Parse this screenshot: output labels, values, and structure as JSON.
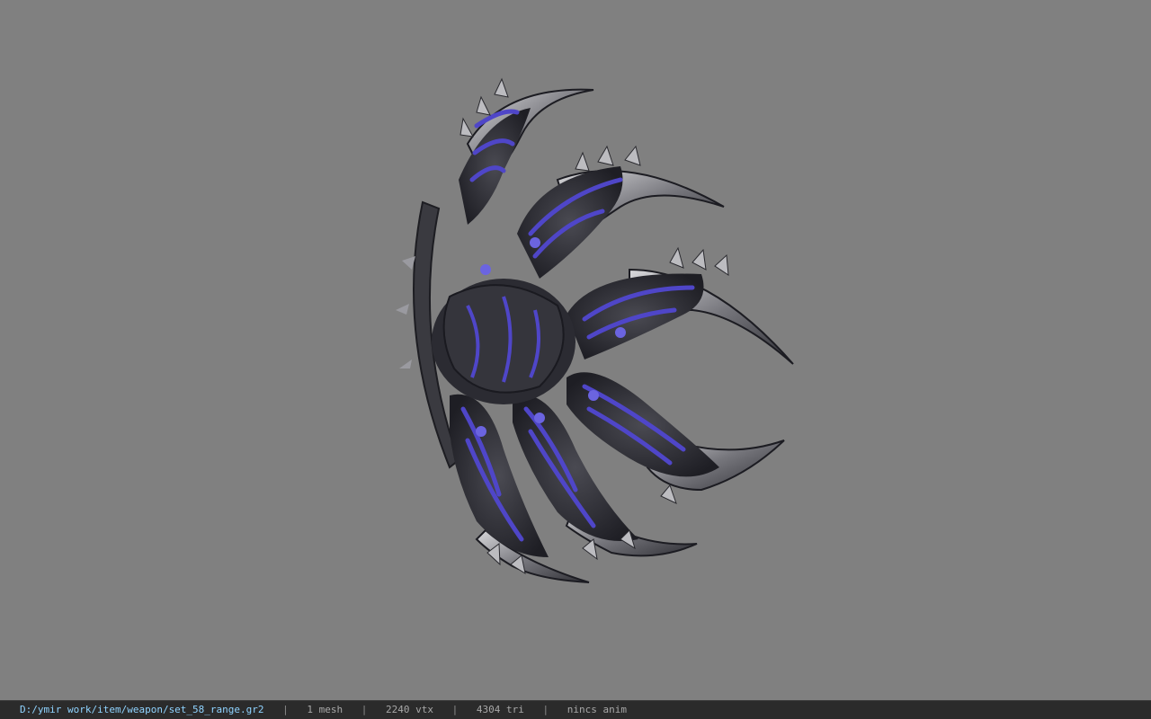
{
  "viewer": {
    "background_color": "#808080",
    "model": {
      "icon": "weapon-model-crescent-claw",
      "colors": {
        "metal_dark": "#2a2a30",
        "metal_mid": "#5c5c62",
        "metal_light": "#c9c9cc",
        "glow": "#4f46c8"
      }
    }
  },
  "status": {
    "file_path": "D:/ymir work/item/weapon/set_58_range.gr2",
    "separator": "|",
    "mesh_count": "1 mesh",
    "vertex_count": "2240 vtx",
    "triangle_count": "4304 tri",
    "anim_state": "nincs anim"
  }
}
